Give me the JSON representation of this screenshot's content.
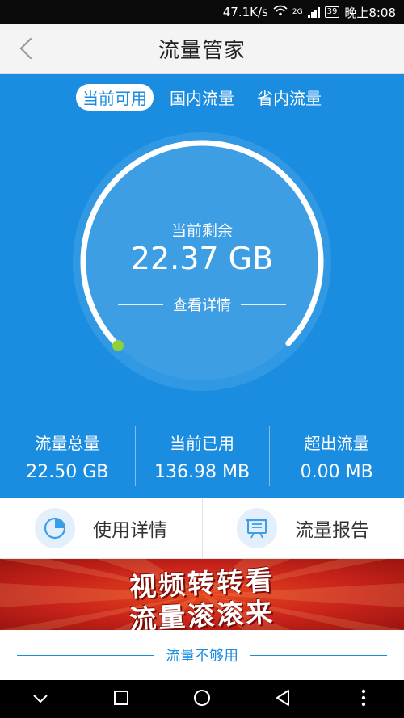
{
  "status_bar": {
    "speed": "47.1K/s",
    "network": "2G",
    "battery": "39",
    "time": "晚上8:08"
  },
  "header": {
    "title": "流量管家",
    "back_icon": "chevron-left-icon"
  },
  "tabs": [
    {
      "label": "当前可用",
      "active": true
    },
    {
      "label": "国内流量",
      "active": false
    },
    {
      "label": "省内流量",
      "active": false
    }
  ],
  "gauge": {
    "label": "当前剩余",
    "value": "22.37 GB",
    "detail_link": "查看详情",
    "remaining_fraction": 0.994
  },
  "stats": [
    {
      "label": "流量总量",
      "value": "22.50 GB"
    },
    {
      "label": "当前已用",
      "value": "136.98 MB"
    },
    {
      "label": "超出流量",
      "value": "0.00 MB"
    }
  ],
  "actions": [
    {
      "label": "使用详情",
      "icon": "pie-chart-icon"
    },
    {
      "label": "流量报告",
      "icon": "report-board-icon"
    }
  ],
  "banner": {
    "line1": "视频转转看",
    "line2": "流量滚滚来"
  },
  "footer_link": "流量不够用",
  "colors": {
    "primary": "#1a8de0",
    "banner_red": "#c8231a",
    "gauge_dot": "#8bd23b"
  }
}
